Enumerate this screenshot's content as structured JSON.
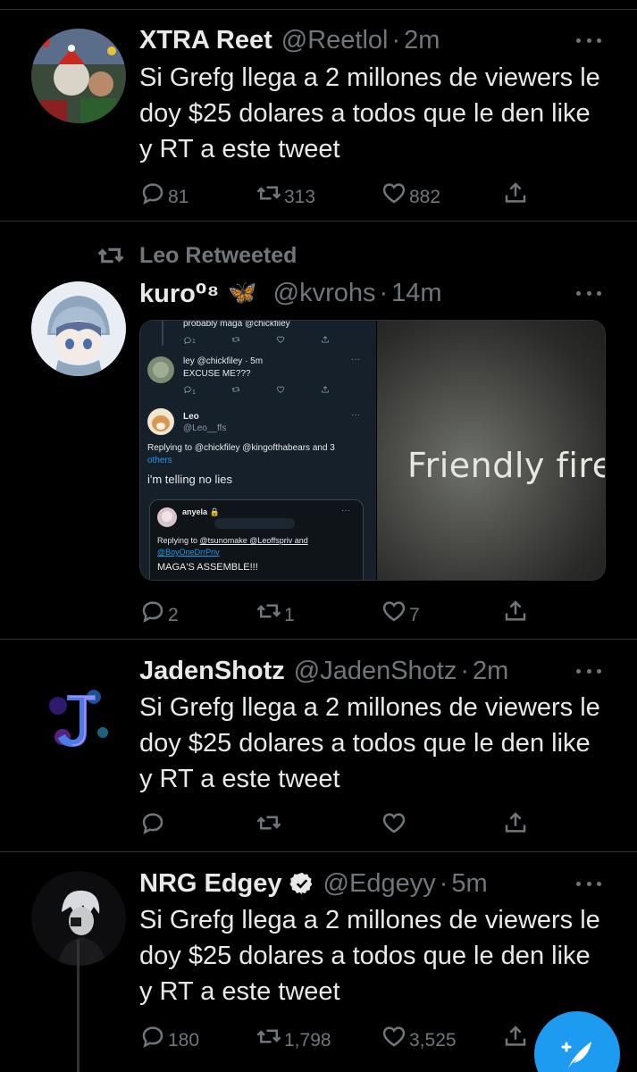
{
  "tweets": [
    {
      "name": "XTRA Reet",
      "handle": "@Reetlol",
      "dot": "·",
      "time": "2m",
      "text": "Si Grefg llega a 2 millones de viewers le doy $25 dolares a todos que le den  like y RT a este tweet",
      "replies": "81",
      "retweets": "313",
      "likes": "882"
    },
    {
      "retweeted_by": "Leo Retweeted",
      "name": "kuro⁰⁸",
      "name_emoji": "🦋",
      "handle": "@kvrohs",
      "dot": "·",
      "time": "14m",
      "replies": "2",
      "retweets": "1",
      "likes": "7",
      "media": {
        "left": {
          "line1": "probably maga",
          "line1_mention": "@chickfiley",
          "count_a": "1",
          "ley_name": "ley",
          "ley_handle": "@chickfiley · 5m",
          "ley_text": "EXCUSE ME???",
          "count_b": "1",
          "leo_name": "Leo",
          "leo_handle": "@Leo__ffs",
          "replying_prefix": "Replying to",
          "replying_mentions": "@chickfiley @kingofthabears and 3",
          "replying_others": "others",
          "leo_text": "i'm telling no lies",
          "anyela_name": "anyela 🔒",
          "anyela_replying_prefix": "Replying to",
          "anyela_replying_mentions": "@tsunomake @Leoffspriv and",
          "anyela_replying_mentions2": "@BoyOneDrrPriv",
          "anyela_text": "MAGA'S ASSEMBLE!!!"
        },
        "right": {
          "caption": "Friendly fire"
        }
      }
    },
    {
      "name": "JadenShotz",
      "handle": "@JadenShotz",
      "dot": "·",
      "time": "2m",
      "text": "Si Grefg llega a 2 millones de viewers le doy $25 dolares a todos que le den  like y RT a este tweet",
      "replies": "",
      "retweets": "",
      "likes": ""
    },
    {
      "name": "NRG Edgey",
      "handle": "@Edgeyy",
      "dot": "·",
      "time": "5m",
      "text": "Si Grefg llega a 2 millones de viewers le doy $25 dolares a todos que le den  like y RT a este tweet",
      "replies": "180",
      "retweets": "1,798",
      "likes": "3,525"
    }
  ],
  "colors": {
    "background": "#000000",
    "secondary_text": "#71767b",
    "accent": "#1d9bf0",
    "verified": "#e7e9ea"
  },
  "icons": [
    "reply-icon",
    "retweet-icon",
    "like-icon",
    "share-icon",
    "more-icon",
    "verified-icon",
    "compose-icon"
  ]
}
